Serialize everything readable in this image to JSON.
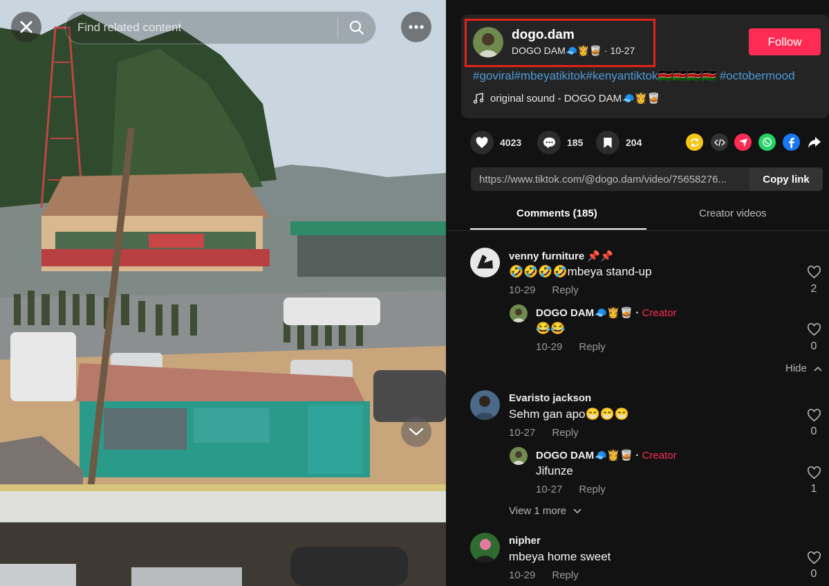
{
  "search": {
    "placeholder": "Find related content"
  },
  "author": {
    "username": "dogo.dam",
    "display": "DOGO DAM🧢👸🥃",
    "date": "10-27",
    "follow_label": "Follow"
  },
  "hashtags": [
    "#goviral",
    "#mbeyatikitok",
    "#kenyantiktok",
    "🇰🇪🇰🇪🇰🇪🇰🇪",
    "#octobermood"
  ],
  "music": "original sound - DOGO DAM🧢👸🥃",
  "actions": {
    "likes": "4023",
    "comments": "185",
    "saves": "204"
  },
  "share_icons": [
    "repost-icon",
    "embed-icon",
    "send-icon",
    "whatsapp-icon",
    "facebook-icon",
    "share-arrow-icon"
  ],
  "link": {
    "url": "https://www.tiktok.com/@dogo.dam/video/75658276...",
    "copy_label": "Copy link"
  },
  "tabs": {
    "comments": "Comments (185)",
    "creator": "Creator videos"
  },
  "comments": [
    {
      "name": "venny furniture 📌📌",
      "text": "🤣🤣🤣🤣mbeya stand-up",
      "date": "10-29",
      "reply": "Reply",
      "likes": "2",
      "replies": [
        {
          "name": "DOGO DAM🧢👸🥃",
          "badge": "Creator",
          "text": "😂😂",
          "date": "10-29",
          "reply": "Reply",
          "likes": "0"
        }
      ],
      "hide": "Hide"
    },
    {
      "name": "Evaristo jackson",
      "text": "Sehm gan apo😁😁😁",
      "date": "10-27",
      "reply": "Reply",
      "likes": "0",
      "replies": [
        {
          "name": "DOGO DAM🧢👸🥃",
          "badge": "Creator",
          "text": "Jifunze",
          "date": "10-27",
          "reply": "Reply",
          "likes": "1"
        }
      ],
      "view_more": "View 1 more"
    },
    {
      "name": "nipher",
      "text": "mbeya home sweet",
      "date": "10-29",
      "reply": "Reply",
      "likes": "0"
    }
  ],
  "colors": {
    "accent": "#fe2c55",
    "hashtag": "#4e9bd9",
    "highlight_box": "#e0241a"
  }
}
